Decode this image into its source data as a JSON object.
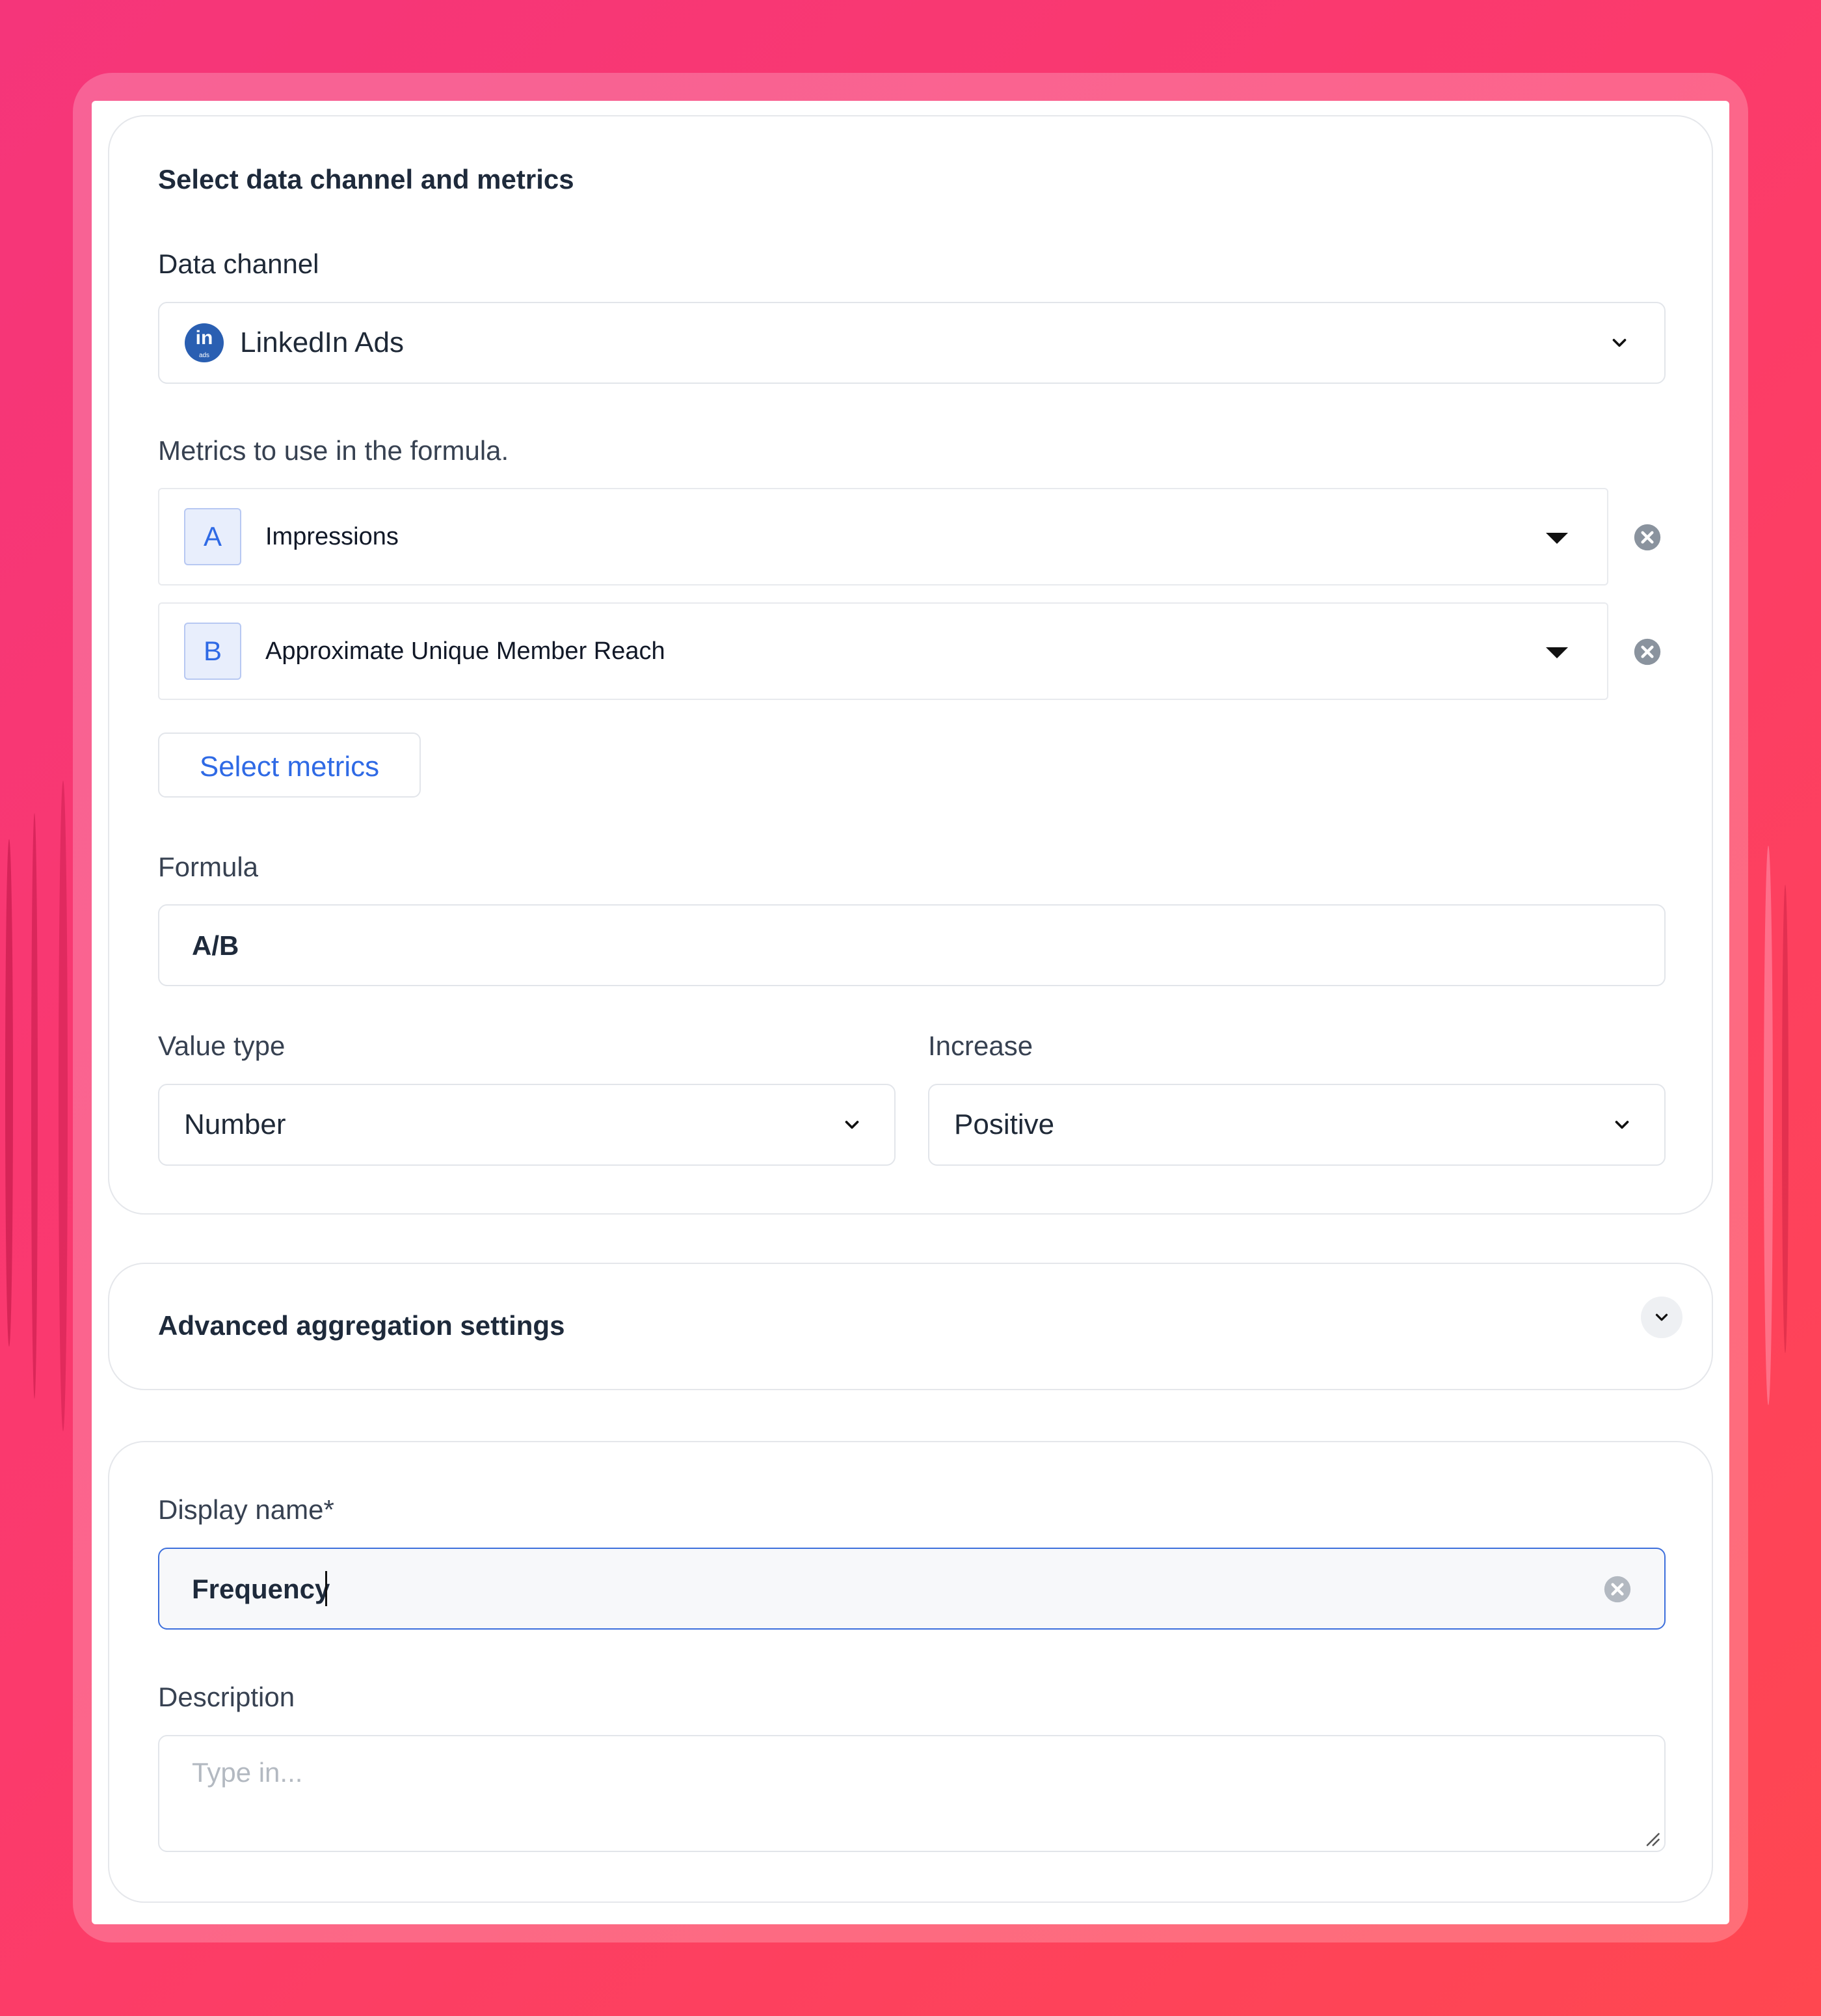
{
  "colors": {
    "accent": "#2f6ae5",
    "background_gradient": [
      "#f5357a",
      "#ff4750"
    ]
  },
  "section_metrics": {
    "title": "Select data channel and metrics",
    "channel_label": "Data channel",
    "channel_value": "LinkedIn Ads",
    "channel_logo_text": "in",
    "channel_logo_subtext": "ads",
    "metrics_label": "Metrics to use in the formula.",
    "metrics": [
      {
        "letter": "A",
        "name": "Impressions"
      },
      {
        "letter": "B",
        "name": "Approximate Unique Member Reach"
      }
    ],
    "select_metrics_button": "Select metrics",
    "formula_label": "Formula",
    "formula_value": "A/B",
    "value_type_label": "Value type",
    "value_type_value": "Number",
    "increase_label": "Increase",
    "increase_value": "Positive"
  },
  "section_advanced": {
    "title": "Advanced aggregation settings"
  },
  "section_details": {
    "display_name_label": "Display name*",
    "display_name_value": "Frequency",
    "description_label": "Description",
    "description_placeholder": "Type in..."
  }
}
